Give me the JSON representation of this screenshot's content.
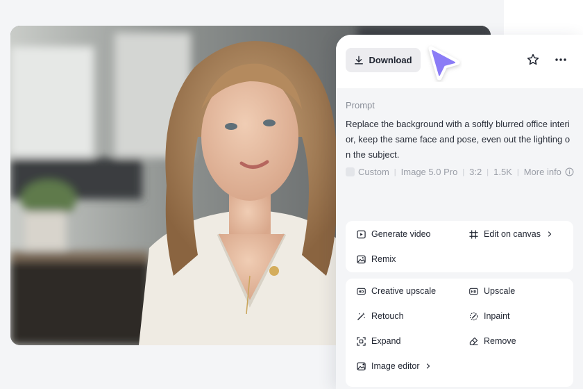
{
  "toolbar": {
    "download_label": "Download",
    "icons": [
      "download-icon",
      "cursor-arrow-icon",
      "star-icon",
      "more-horizontal-icon"
    ],
    "accent": "#8b7cf6"
  },
  "prompt": {
    "label": "Prompt",
    "text": "Replace the background with a softly blurred office interi\nor, keep the same face and pose, even out the lighting o\nn the subject."
  },
  "meta": {
    "style": "Custom",
    "model": "Image 5.0 Pro",
    "aspect": "3:2",
    "resolution": "1.5K",
    "more_info": "More info"
  },
  "actions_primary": [
    {
      "label": "Generate video",
      "icon": "play-video-icon"
    },
    {
      "label": "Edit on canvas",
      "icon": "canvas-crop-icon"
    },
    {
      "label": "Remix",
      "icon": "remix-image-icon"
    }
  ],
  "actions_secondary": [
    {
      "label": "Creative upscale",
      "icon": "hd-icon"
    },
    {
      "label": "Upscale",
      "icon": "hd-icon"
    },
    {
      "label": "Retouch",
      "icon": "magic-wand-icon"
    },
    {
      "label": "Inpaint",
      "icon": "inpaint-brush-icon"
    },
    {
      "label": "Expand",
      "icon": "expand-icon"
    },
    {
      "label": "Remove",
      "icon": "eraser-icon"
    },
    {
      "label": "Image editor",
      "icon": "image-editor-icon"
    }
  ]
}
